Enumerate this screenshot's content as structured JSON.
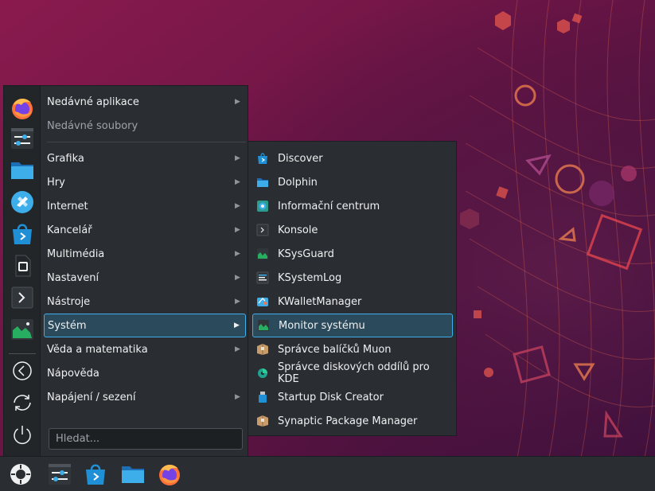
{
  "favorites": [
    {
      "name": "firefox-icon"
    },
    {
      "name": "system-settings-icon"
    },
    {
      "name": "dolphin-folder-icon"
    },
    {
      "name": "kde-connect-icon"
    },
    {
      "name": "discover-store-icon"
    },
    {
      "name": "kate-document-icon"
    },
    {
      "name": "konsole-terminal-icon"
    },
    {
      "name": "ksysguard-monitor-icon"
    }
  ],
  "session_actions": [
    {
      "name": "logout-icon"
    },
    {
      "name": "restart-icon"
    },
    {
      "name": "shutdown-icon"
    }
  ],
  "categories": [
    {
      "label": "Nedávné aplikace",
      "submenu": true
    },
    {
      "label": "Nedávné soubory",
      "submenu": false
    },
    {
      "label": "Grafika",
      "submenu": true
    },
    {
      "label": "Hry",
      "submenu": true
    },
    {
      "label": "Internet",
      "submenu": true
    },
    {
      "label": "Kancelář",
      "submenu": true
    },
    {
      "label": "Multimédia",
      "submenu": true
    },
    {
      "label": "Nastavení",
      "submenu": true
    },
    {
      "label": "Nástroje",
      "submenu": true
    },
    {
      "label": "Systém",
      "submenu": true,
      "active": true
    },
    {
      "label": "Věda a matematika",
      "submenu": true
    },
    {
      "label": "Nápověda",
      "submenu": false
    },
    {
      "label": "Napájení / sezení",
      "submenu": true
    }
  ],
  "search": {
    "placeholder": "Hledat..."
  },
  "system_apps": [
    {
      "label": "Discover",
      "icon": "discover-icon"
    },
    {
      "label": "Dolphin",
      "icon": "folder-icon"
    },
    {
      "label": "Informační centrum",
      "icon": "info-center-icon"
    },
    {
      "label": "Konsole",
      "icon": "terminal-icon"
    },
    {
      "label": "KSysGuard",
      "icon": "ksysguard-icon"
    },
    {
      "label": "KSystemLog",
      "icon": "system-log-icon"
    },
    {
      "label": "KWalletManager",
      "icon": "wallet-icon"
    },
    {
      "label": "Monitor systému",
      "icon": "system-monitor-icon",
      "active": true
    },
    {
      "label": "Správce balíčků Muon",
      "icon": "package-box-icon"
    },
    {
      "label": "Správce diskových oddílů pro KDE",
      "icon": "partition-manager-icon"
    },
    {
      "label": "Startup Disk Creator",
      "icon": "usb-drive-icon"
    },
    {
      "label": "Synaptic Package Manager",
      "icon": "package-box-icon"
    }
  ],
  "panel": [
    {
      "name": "application-launcher-icon"
    },
    {
      "name": "system-settings-icon"
    },
    {
      "name": "discover-store-icon"
    },
    {
      "name": "dolphin-folder-icon"
    },
    {
      "name": "firefox-icon"
    }
  ],
  "colors": {
    "accent": "#3daee9",
    "menu_bg": "#2a2e32",
    "wallpaper_top": "#8a1a4e",
    "wallpaper_bottom": "#3a0f3a"
  },
  "submenu_arrow": "▶"
}
